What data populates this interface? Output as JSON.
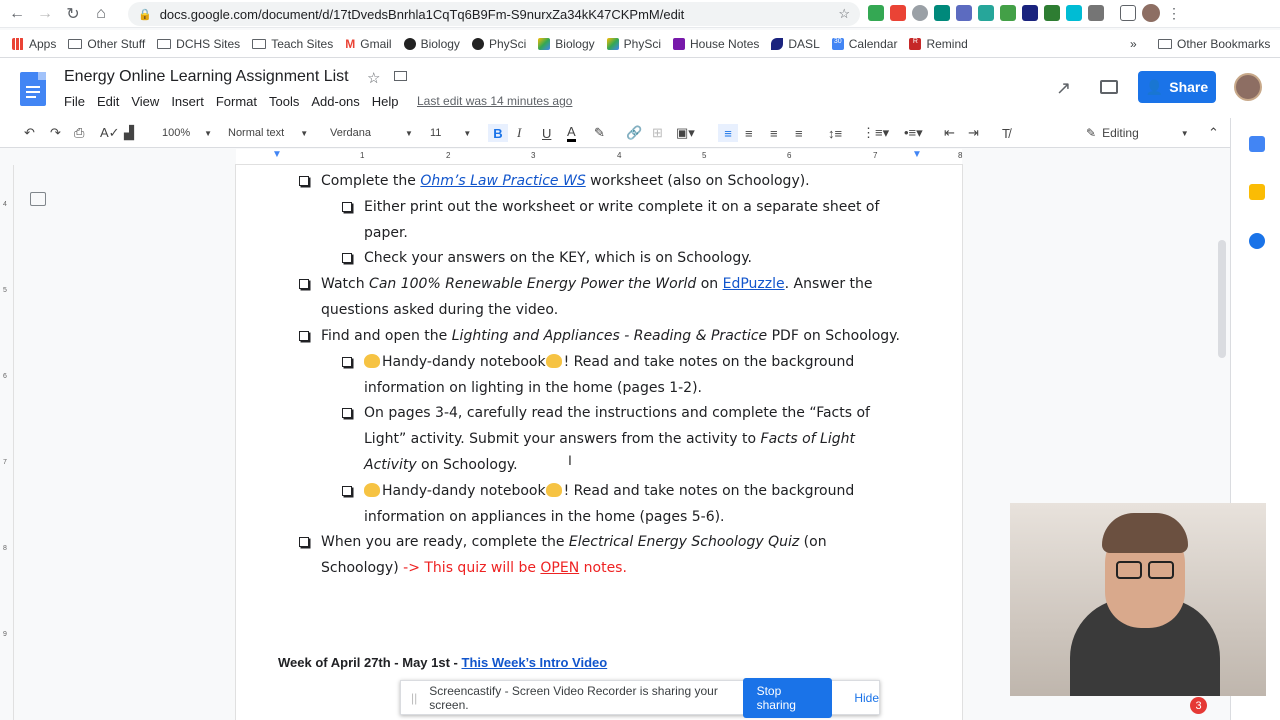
{
  "browser": {
    "url": "docs.google.com/document/d/17tDvedsBnrhla1CqTq6B9Fm-S9nurxZa34kK47CKPmM/edit",
    "bookmarks": [
      "Apps",
      "Other Stuff",
      "DCHS Sites",
      "Teach Sites",
      "Gmail",
      "Biology",
      "PhySci",
      "Biology",
      "PhySci",
      "House Notes",
      "DASL",
      "Calendar",
      "Remind"
    ],
    "other_bookmarks": "Other Bookmarks",
    "calendar_icon_text": "30",
    "remind_icon_text": "R"
  },
  "docs": {
    "title": "Energy Online Learning Assignment List",
    "menus": [
      "File",
      "Edit",
      "View",
      "Insert",
      "Format",
      "Tools",
      "Add-ons",
      "Help"
    ],
    "last_edit": "Last edit was 14 minutes ago",
    "share_label": "Share",
    "zoom": "100%",
    "style": "Normal text",
    "font": "Verdana",
    "font_size": "11",
    "mode": "Editing",
    "ruler_numbers": [
      "1",
      "2",
      "3",
      "4",
      "5",
      "6",
      "7",
      "8"
    ],
    "vruler_numbers": [
      "4",
      "5",
      "6",
      "7",
      "8",
      "9"
    ]
  },
  "content": {
    "l1a": "Complete the ",
    "l1link": "Ohm’s Law Practice WS",
    "l1b": " worksheet (also on Schoology).",
    "l2": "Either print out the worksheet or write complete it on a separate sheet of",
    "l2b": "paper.",
    "l3": "Check your answers on the KEY, which is on Schoology.",
    "l4a": "Watch ",
    "l4i": "Can 100% Renewable Energy Power the World",
    "l4b": " on ",
    "l4link": "EdPuzzle",
    "l4c": ". Answer the",
    "l4d": "questions asked during the video.",
    "l5a": "Find and open the ",
    "l5i": "Lighting and Appliances - Reading & Practice",
    "l5b": " PDF on Schoology.",
    "l6a": "Handy-dandy notebook",
    "l6b": "! Read and take notes on the background",
    "l6c": "information on lighting in the home (pages 1-2).",
    "l7a": "On pages 3-4, carefully read the instructions and complete the “Facts of",
    "l7b": "Light” activity. Submit your answers from the activity to ",
    "l7i": "Facts of Light",
    "l7c": "Activity",
    "l7d": " on Schoology.",
    "l8a": "Handy-dandy notebook",
    "l8b": "! Read and take notes on the background",
    "l8c": "information on appliances in the home (pages 5-6).",
    "l9a": "When you are ready, complete the ",
    "l9i": "Electrical Energy Schoology Quiz",
    "l9b": " (on",
    "l9c": "Schoology) ",
    "l9r1": "-> This quiz will be ",
    "l9r2": "OPEN",
    "l9r3": " notes.",
    "week_a": "Week of April 27th - May 1st - ",
    "week_link": "This Week’s Intro Video"
  },
  "notification": {
    "text": "Screencastify - Screen Video Recorder is sharing your screen.",
    "stop": "Stop sharing",
    "hide": "Hide"
  },
  "badge_count": "3"
}
